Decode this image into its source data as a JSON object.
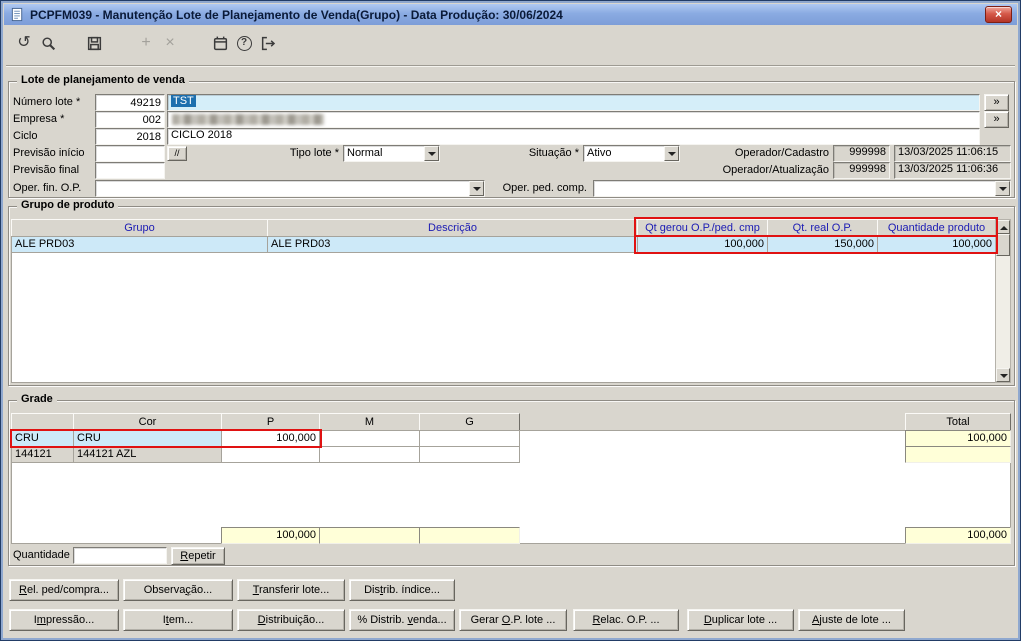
{
  "window": {
    "title": "PCPFM039 - Manutenção Lote de Planejamento de Venda(Grupo) - Data Produção: 30/06/2024",
    "close_glyph": "×"
  },
  "toolbar": {
    "undo_glyph": "↺",
    "add_glyph": "+",
    "delete_glyph": "×",
    "help_glyph": "?",
    "icons": [
      "undo-icon",
      "search-icon",
      "save-icon",
      "add-icon",
      "delete-icon",
      "calendar-icon",
      "help-icon",
      "exit-icon"
    ]
  },
  "lote": {
    "legend": "Lote de planejamento de venda",
    "zoom_glyph": "»",
    "date_helper_glyph": "//",
    "numero_lote": {
      "label": "Número lote *",
      "value": "49219",
      "descricao_selecionada": "TST"
    },
    "empresa": {
      "label": "Empresa *",
      "value": "002"
    },
    "ciclo": {
      "label": "Ciclo",
      "value": "2018",
      "descricao": "CICLO 2018"
    },
    "previsao_inicio": {
      "label": "Previsão início",
      "value": ""
    },
    "previsao_final": {
      "label": "Previsão final",
      "value": ""
    },
    "tipo_lote": {
      "label": "Tipo lote *",
      "value": "Normal"
    },
    "situacao": {
      "label": "Situação *",
      "value": "Ativo"
    },
    "operador_cadastro": {
      "label": "Operador/Cadastro",
      "codigo": "999998",
      "datahora": "13/03/2025 11:06:15"
    },
    "operador_atualizacao": {
      "label": "Operador/Atualização",
      "codigo": "999998",
      "datahora": "13/03/2025 11:06:36"
    },
    "oper_fin_op": {
      "label": "Oper. fin. O.P.",
      "value": ""
    },
    "oper_ped_comp": {
      "label": "Oper. ped. comp.",
      "value": ""
    }
  },
  "grupo_produto": {
    "legend": "Grupo de produto",
    "headers": {
      "grupo": "Grupo",
      "descricao": "Descrição",
      "qt_gerou": "Qt gerou O.P./ped. cmp",
      "qt_real": "Qt. real O.P.",
      "quantidade": "Quantidade produto"
    },
    "row": {
      "grupo": "ALE PRD03",
      "descricao": "ALE PRD03",
      "qt_gerou": "100,000",
      "qt_real": "150,000",
      "quantidade": "100,000"
    }
  },
  "grade": {
    "legend": "Grade",
    "headers": {
      "codigo": "",
      "cor": "Cor",
      "p": "P",
      "m": "M",
      "g": "G",
      "total": "Total"
    },
    "rows": [
      {
        "codigo": "CRU",
        "cor": "CRU",
        "p": "100,000",
        "m": "",
        "g": "",
        "total": "100,000"
      },
      {
        "codigo": "144121",
        "cor": "144121 AZL",
        "p": "",
        "m": "",
        "g": "",
        "total": ""
      }
    ],
    "totais": {
      "p": "100,000",
      "m": "",
      "g": "",
      "total": "100,000"
    },
    "quantidade": {
      "label": "Quantidade",
      "value": ""
    },
    "repetir_button": {
      "label": "Repetir",
      "accel": 0
    }
  },
  "actions": {
    "row1": [
      {
        "label": "Rel. ped/compra...",
        "accel": 0
      },
      {
        "label": "Observação...",
        "accel": 7
      },
      {
        "label": "Transferir lote...",
        "accel": 0
      },
      {
        "label": "Distrib. índice...",
        "accel": 3
      }
    ],
    "row2": [
      {
        "label": "Impressão...",
        "accel": 1
      },
      {
        "label": "Item...",
        "accel": 1
      },
      {
        "label": "Distribuição...",
        "accel": 0
      },
      {
        "label": "% Distrib. venda...",
        "accel": 11
      },
      {
        "label": "Gerar O.P. lote ...",
        "accel": 6
      },
      {
        "label": "Relac. O.P. ...",
        "accel": 0
      },
      {
        "label": "Duplicar lote ...",
        "accel": 0
      },
      {
        "label": "Ajuste de lote ...",
        "accel": 0
      }
    ]
  },
  "colors": {
    "annotation_red": "#e01212",
    "selection_blue": "#cde9f8",
    "field_focus_blue": "#d5eef9",
    "total_yellow": "#ffffd8",
    "header_text_blue": "#1b1bb4"
  }
}
